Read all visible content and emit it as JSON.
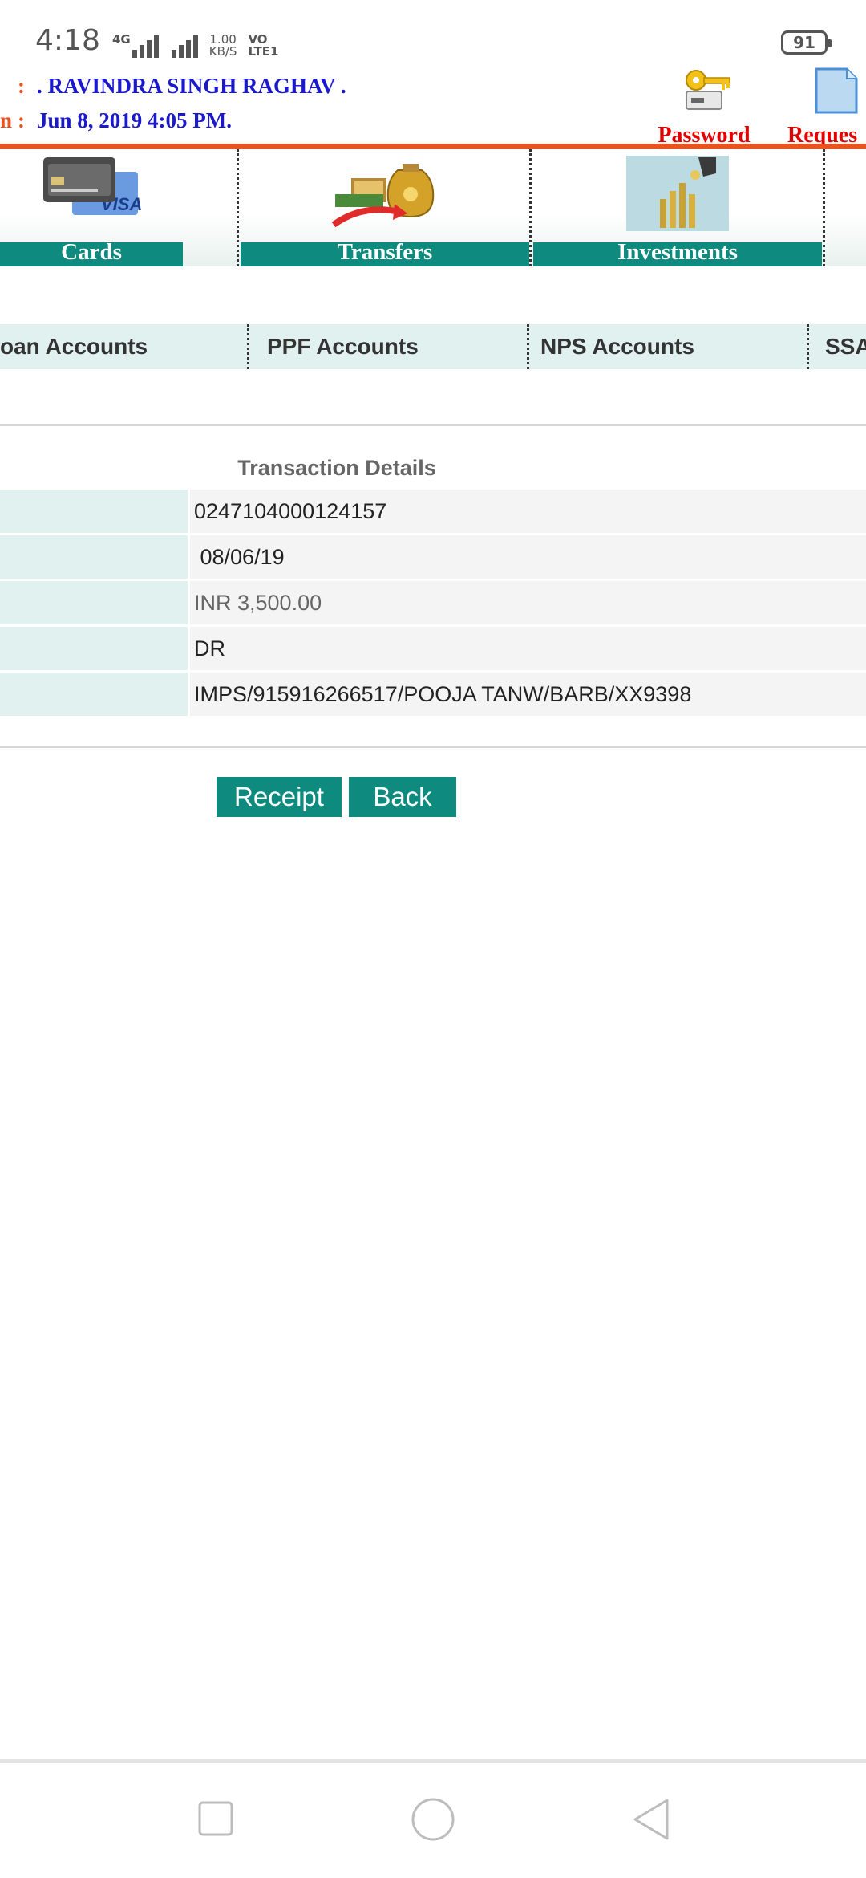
{
  "status_bar": {
    "time": "4:18",
    "net_type": "4G",
    "speed_value": "1.00",
    "speed_unit": "KB/S",
    "volte_top": "VO",
    "volte_bottom": "LTE1",
    "battery": "91"
  },
  "header": {
    "name_label": "n",
    "name_colon": ":",
    "name_value": ". RAVINDRA SINGH RAGHAV .",
    "login_label": "n",
    "login_colon": ":",
    "login_value": "Jun 8, 2019 4:05 PM.",
    "password_link": "Password",
    "request_link": "Reques"
  },
  "nav_tiles": [
    {
      "label": "Cards",
      "icon": "credit-card-icon"
    },
    {
      "label": "Transfers",
      "icon": "money-bag-transfer-icon"
    },
    {
      "label": "Investments",
      "icon": "coins-stack-icon"
    }
  ],
  "account_tabs": [
    {
      "label": "oan Accounts"
    },
    {
      "label": "PPF Accounts"
    },
    {
      "label": "NPS Accounts"
    },
    {
      "label": "SSA"
    }
  ],
  "details": {
    "title": "Transaction Details",
    "rows": [
      {
        "value": "0247104000124157"
      },
      {
        "value": " 08/06/19"
      },
      {
        "value": "INR 3,500.00"
      },
      {
        "value": "DR"
      },
      {
        "value": "IMPS/915916266517/POOJA TANW/BARB/XX9398"
      }
    ]
  },
  "buttons": {
    "receipt": "Receipt",
    "back": "Back"
  },
  "colors": {
    "accent_teal": "#0e8a7e",
    "header_orange": "#e8541f",
    "name_blue": "#1a1acc",
    "link_red": "#e00000"
  }
}
